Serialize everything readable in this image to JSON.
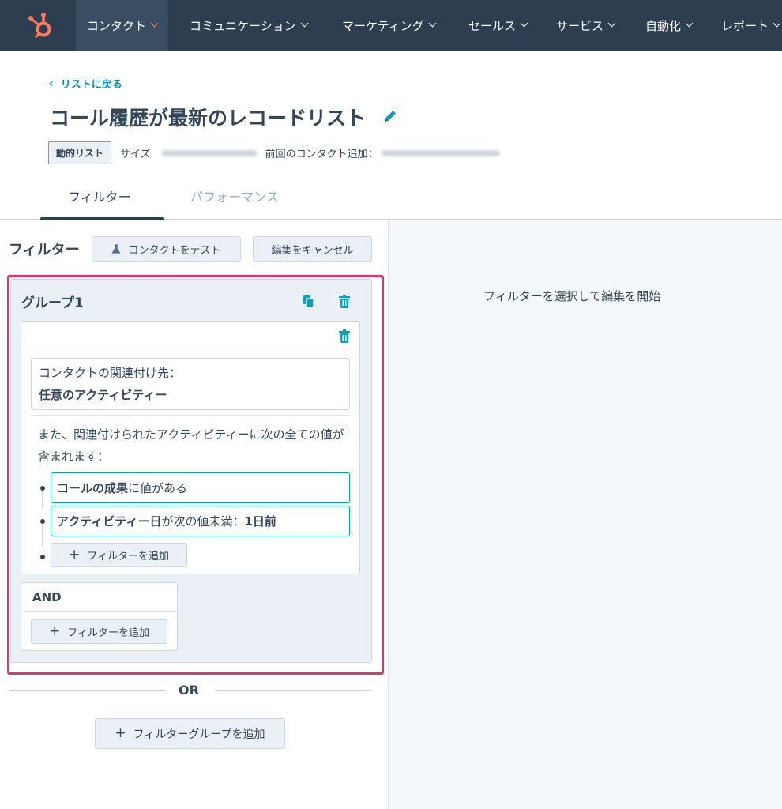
{
  "nav": {
    "items": [
      "コンタクト",
      "コミュニケーション",
      "マーケティング",
      "セールス",
      "サービス",
      "自動化",
      "レポート"
    ]
  },
  "header": {
    "back_label": "リストに戻る",
    "title": "コール履歴が最新のレコードリスト",
    "list_type_badge": "動的リスト",
    "size_label": "サイズ",
    "last_added_label": "前回のコンタクト追加："
  },
  "tabs": [
    "フィルター",
    "パフォーマンス"
  ],
  "filter_panel": {
    "heading": "フィルター",
    "test_button": "コンタクトをテスト",
    "cancel_button": "編集をキャンセル",
    "group": {
      "title": "グループ1",
      "association_line1": "コンタクトの関連付け先：",
      "association_line2": "任意のアクティビティー",
      "description": "また、関連付けられたアクティビティーに次の全ての値が含まれます：",
      "conditions": [
        {
          "bold": "コールの成果",
          "rest": "に値がある",
          "value": ""
        },
        {
          "bold": "アクティビティー日",
          "rest": "が次の値未満：",
          "value": "1日前"
        }
      ],
      "add_filter_button": "フィルターを追加",
      "and_label": "AND",
      "and_add_filter_button": "フィルターを追加"
    },
    "or_label": "OR",
    "add_group_button": "フィルターグループを追加"
  },
  "right_panel": {
    "message": "フィルターを選択して編集を開始"
  },
  "colors": {
    "nav_bg": "#2d3e50",
    "brand_orange": "#ff7a59",
    "link_teal": "#0091ae",
    "highlight_pink": "#e8306c",
    "condition_border": "#00a4bd"
  },
  "icons": [
    "hubspot-logo-icon",
    "chevron-down-icon",
    "chevron-left-icon",
    "pencil-icon",
    "flask-icon",
    "copy-icon",
    "trash-icon",
    "plus-icon"
  ]
}
